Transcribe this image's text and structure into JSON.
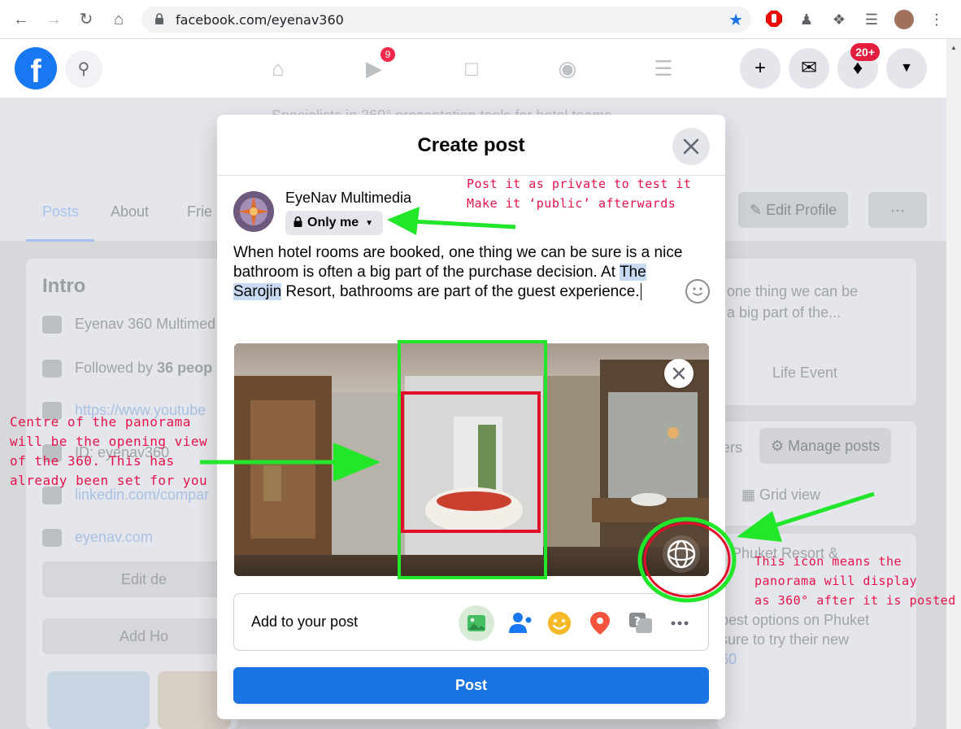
{
  "browser": {
    "url": "facebook.com/eyenav360",
    "icons": [
      "back-arrow-icon",
      "forward-arrow-icon",
      "reload-icon",
      "home-icon",
      "lock-icon",
      "bookmark-star-icon",
      "adblock-icon",
      "extension-icon",
      "puzzle-icon",
      "media-icon",
      "profile-avatar",
      "menu-dots-icon"
    ]
  },
  "fb_header": {
    "logo": "f",
    "watch_badge": "9",
    "notifications_badge": "20+"
  },
  "page": {
    "subtitle": "Specialists in 360° presentation tools for hotel teams",
    "tabs": [
      "Posts",
      "About",
      "Frie"
    ],
    "edit_profile": "Edit Profile",
    "more": "···",
    "intro": {
      "title": "Intro",
      "rows": [
        {
          "text": "Eyenav 360 Multimed"
        },
        {
          "text_prefix": "Followed by ",
          "bold": "36 peop"
        },
        {
          "text": "https://www.youtube"
        },
        {
          "text": "ID: eyenav360"
        },
        {
          "text": "linkedin.com/compar"
        },
        {
          "text": "eyenav.com"
        }
      ],
      "edit_btn": "Edit de",
      "add_btn": "Add Ho"
    },
    "right": {
      "composer_preview_1": "one thing we can be",
      "composer_preview_2": "a big part of the...",
      "life_event": "Life Event",
      "filters": "ers",
      "manage_posts": "Manage posts",
      "grid_view": "Grid view",
      "post_title": "Phuket Resort &",
      "post_line1": "best options on Phuket",
      "post_line2": "sure to try their new",
      "post_line3": "60"
    }
  },
  "modal": {
    "title": "Create post",
    "author": "EyeNav Multimedia",
    "privacy": "Only me",
    "text_before": "When hotel rooms are booked, one thing we can be sure is a nice bathroom is often a big part of the purchase decision. At ",
    "text_highlight_1": "The",
    "text_highlight_2": "Sarojin",
    "text_after": " Resort, bathrooms are part of the guest experience.",
    "add_to_post": "Add to your post",
    "add_icons": [
      "photo-video-icon",
      "tag-people-icon",
      "feeling-icon",
      "check-in-icon",
      "ask-question-icon",
      "more-options-icon"
    ],
    "post_button": "Post"
  },
  "annotations": {
    "privacy_note": "Post it as private to test it\nMake it ‘public’ afterwards",
    "centre_note": "Centre of the panorama\nwill be the opening view\nof the 360. This has\nalready been set for you",
    "icon_note": "This icon means the\npanorama will display\nas 360° after it is posted"
  },
  "colors": {
    "fb_blue": "#1877f2",
    "post_button": "#1b74e4",
    "annotation_text": "#e8124a",
    "annotation_green": "#22e62a",
    "annotation_red": "#e0102a"
  }
}
